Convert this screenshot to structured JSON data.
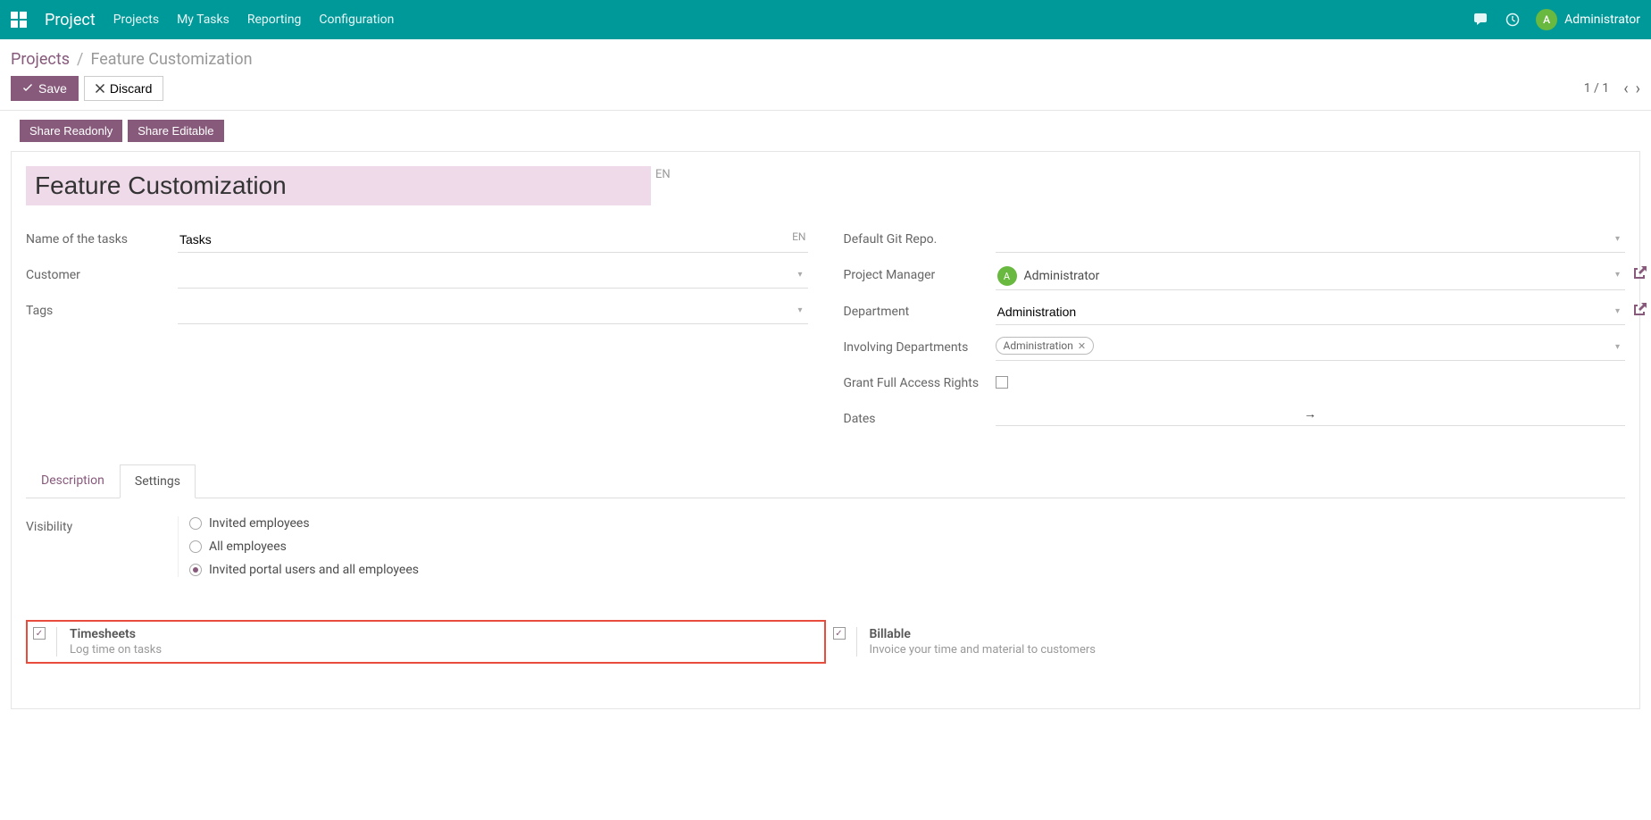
{
  "header": {
    "app_title": "Project",
    "nav": {
      "projects": "Projects",
      "my_tasks": "My Tasks",
      "reporting": "Reporting",
      "configuration": "Configuration"
    },
    "user_initial": "A",
    "user_name": "Administrator"
  },
  "breadcrumb": {
    "root": "Projects",
    "current": "Feature Customization"
  },
  "actions": {
    "save": "Save",
    "discard": "Discard",
    "pager": "1 / 1",
    "share_readonly": "Share Readonly",
    "share_editable": "Share Editable"
  },
  "form": {
    "title_value": "Feature Customization",
    "title_lang": "EN",
    "left": {
      "name_of_tasks": {
        "label": "Name of the tasks",
        "value": "Tasks",
        "lang": "EN"
      },
      "customer": {
        "label": "Customer",
        "value": ""
      },
      "tags": {
        "label": "Tags",
        "value": ""
      }
    },
    "right": {
      "default_git": {
        "label": "Default Git Repo.",
        "value": ""
      },
      "project_manager": {
        "label": "Project Manager",
        "value": "Administrator",
        "initial": "A"
      },
      "department": {
        "label": "Department",
        "value": "Administration"
      },
      "involving_departments": {
        "label": "Involving Departments",
        "tag": "Administration"
      },
      "grant_full_access": {
        "label": "Grant Full Access Rights"
      },
      "dates": {
        "label": "Dates"
      }
    }
  },
  "tabs": {
    "description": "Description",
    "settings": "Settings"
  },
  "settings": {
    "visibility_label": "Visibility",
    "radios": {
      "invited": "Invited employees",
      "all": "All employees",
      "portal": "Invited portal users and all employees"
    },
    "timesheets": {
      "title": "Timesheets",
      "desc": "Log time on tasks"
    },
    "billable": {
      "title": "Billable",
      "desc": "Invoice your time and material to customers"
    }
  }
}
